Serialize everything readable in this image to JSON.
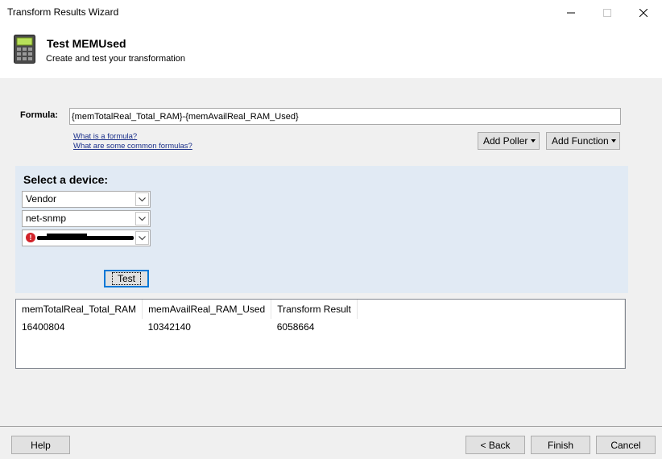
{
  "window": {
    "title": "Transform Results Wizard"
  },
  "header": {
    "title": "Test MEMUsed",
    "subtitle": "Create and test your transformation"
  },
  "formula": {
    "label": "Formula:",
    "value": "{memTotalReal_Total_RAM}-{memAvailReal_RAM_Used}",
    "link_what": "What is a formula?",
    "link_common": "What are some common formulas?",
    "add_poller": "Add Poller",
    "add_function": "Add Function"
  },
  "device": {
    "title": "Select a device:",
    "combo1": "Vendor",
    "combo2": "net-snmp",
    "test_label": "Test"
  },
  "results": {
    "columns": [
      "memTotalReal_Total_RAM",
      "memAvailReal_RAM_Used",
      "Transform Result"
    ],
    "rows": [
      [
        "16400804",
        "10342140",
        "6058664"
      ]
    ]
  },
  "footer": {
    "help": "Help",
    "back": "< Back",
    "finish": "Finish",
    "cancel": "Cancel"
  },
  "icons": {
    "header": "calculator-icon",
    "error": "error-icon"
  }
}
